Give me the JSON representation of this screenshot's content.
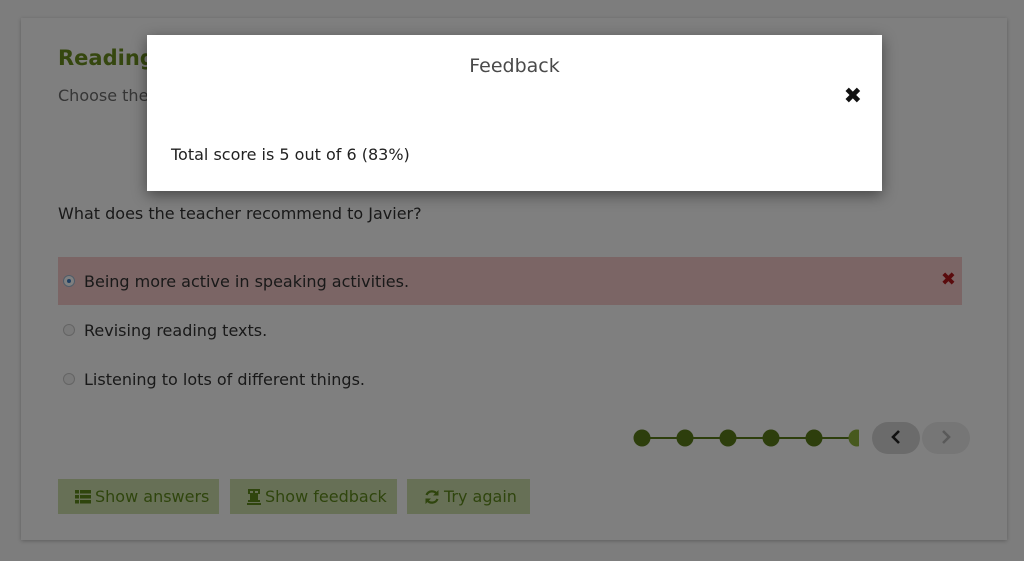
{
  "task": {
    "title": "Reading",
    "instruction": "Choose the",
    "question": "What does the teacher recommend to Javier?"
  },
  "options": [
    {
      "label": "Being more active in speaking activities.",
      "selected": true,
      "result": "wrong"
    },
    {
      "label": "Revising reading texts.",
      "selected": false,
      "result": ""
    },
    {
      "label": "Listening to lots of different things.",
      "selected": false,
      "result": ""
    }
  ],
  "progress": {
    "total_dots": 6,
    "current_index": 6,
    "dot_color": "#5a7d18",
    "current_dot_color": "#8eb33d"
  },
  "nav": {
    "prev_icon": "chevron-left-icon",
    "next_icon": "chevron-right-icon"
  },
  "buttons": {
    "show_answers": "Show answers",
    "show_feedback": "Show feedback",
    "try_again": "Try again"
  },
  "modal": {
    "title": "Feedback",
    "close_icon": "close-icon",
    "score_text": "Total score is 5 out of 6 (83%)"
  },
  "colors": {
    "accent": "#6b8e1e",
    "wrong_bg": "#f7cbcb",
    "wrong_mark": "#b5161b",
    "button_bg": "#cfe0ad"
  }
}
